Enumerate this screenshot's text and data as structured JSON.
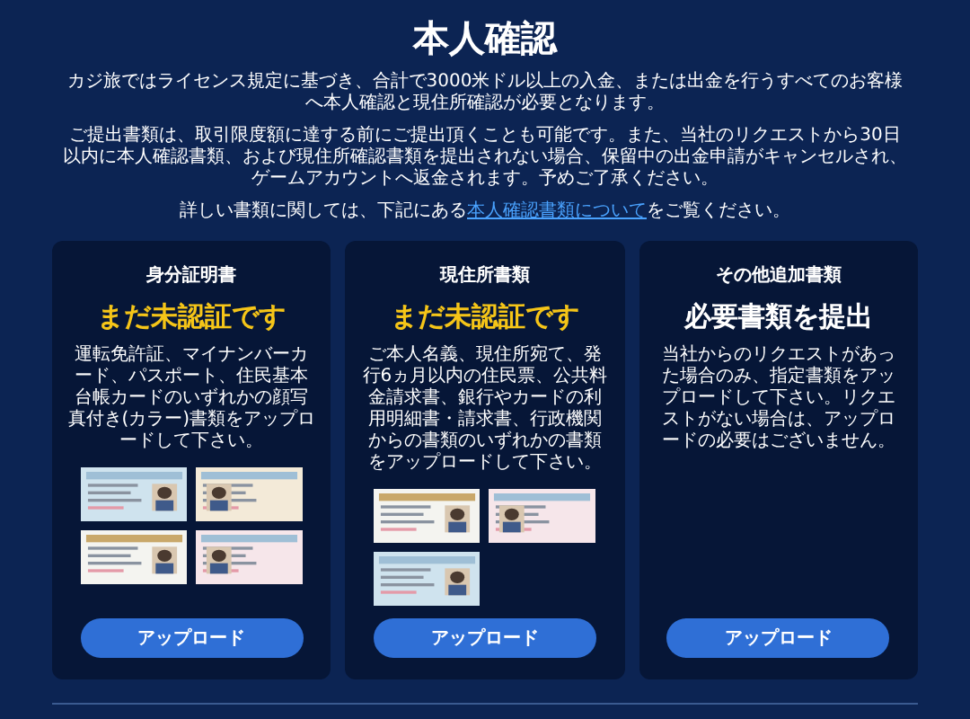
{
  "title": "本人確認",
  "intro": [
    "カジ旅ではライセンス規定に基づき、合計で3000米ドル以上の入金、または出金を行うすべてのお客様へ本人確認と現住所確認が必要となります。",
    "ご提出書類は、取引限度額に達する前にご提出頂くことも可能です。また、当社のリクエストから30日以内に本人確認書類、および現住所確認書類を提出されない場合、保留中の出金申請がキャンセルされ、ゲームアカウントへ返金されます。予めご了承ください。"
  ],
  "details": {
    "before": "詳しい書類に関しては、下記にある",
    "link": "本人確認書類について",
    "after": "をご覧ください。"
  },
  "cards": [
    {
      "heading": "身分証明書",
      "status": {
        "kind": "unverified",
        "text": "まだ未認証です"
      },
      "description": "運転免許証、マイナンバーカード、パスポート、住民基本台帳カードのいずれかの顔写真付き(カラー)書類をアップロードして下さい。",
      "button": "アップロード"
    },
    {
      "heading": "現住所書類",
      "status": {
        "kind": "unverified",
        "text": "まだ未認証です"
      },
      "description": "ご本人名義、現住所宛て、発行6ヵ月以内の住民票、公共料金請求書、銀行やカードの利用明細書・請求書、行政機関からの書類のいずれかの書類をアップロードして下さい。",
      "button": "アップロード"
    },
    {
      "heading": "その他追加書類",
      "status": {
        "kind": "required",
        "text": "必要書類を提出"
      },
      "description": "当社からのリクエストがあった場合のみ、指定書類をアップロードして下さい。リクエストがない場合は、アップロードの必要はございません。",
      "button": "アップロード"
    }
  ]
}
